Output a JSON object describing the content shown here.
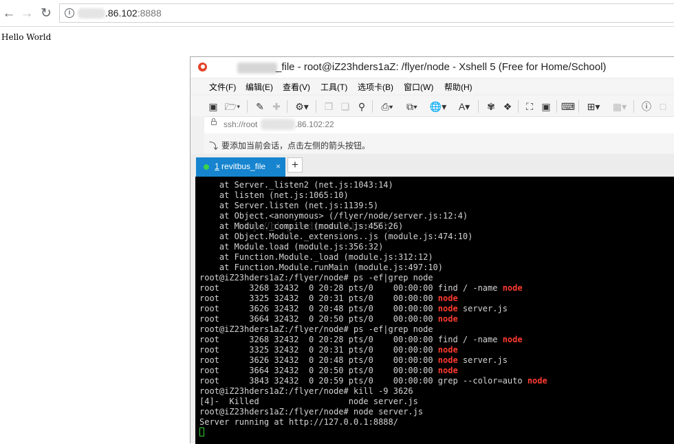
{
  "browser": {
    "url_host": ".86.102",
    "url_port": ":8888"
  },
  "page": {
    "text": "Hello World"
  },
  "xshell": {
    "title": "_file - root@iZ23hders1aZ: /flyer/node - Xshell 5 (Free for Home/School)",
    "menu": [
      "文件(F)",
      "编辑(E)",
      "查看(V)",
      "工具(T)",
      "选项卡(B)",
      "窗口(W)",
      "帮助(H)"
    ],
    "address": {
      "prefix": "ssh://root",
      "suffix": ".86.102:22"
    },
    "hint": "要添加当前会话，点击左侧的箭头按钮。",
    "tab": {
      "num": "1",
      "label": " revitbus_file",
      "close": "×",
      "add": "+"
    },
    "watermark": "http://blog.csdn.net/AlbertFly",
    "terminal_lines": [
      {
        "text": "    at Server._listen2 (net.js:1043:14)"
      },
      {
        "text": "    at listen (net.js:1065:10)"
      },
      {
        "text": "    at Server.listen (net.js:1139:5)"
      },
      {
        "text": "    at Object.<anonymous> (/flyer/node/server.js:12:4)"
      },
      {
        "text": "    at Module._compile (module.js:456:26)"
      },
      {
        "text": "    at Object.Module._extensions..js (module.js:474:10)"
      },
      {
        "text": "    at Module.load (module.js:356:32)"
      },
      {
        "text": "    at Function.Module._load (module.js:312:12)"
      },
      {
        "text": "    at Function.Module.runMain (module.js:497:10)"
      },
      {
        "text": "root@iZ23hders1aZ:/flyer/node# ps -ef|grep node"
      },
      {
        "text": "root      3268 32432  0 20:28 pts/0    00:00:00 find / -name ",
        "hl": "node"
      },
      {
        "text": "root      3325 32432  0 20:31 pts/0    00:00:00 ",
        "hl": "node"
      },
      {
        "text": "root      3626 32432  0 20:48 pts/0    00:00:00 ",
        "hl": "node",
        "after": " server.js"
      },
      {
        "text": "root      3664 32432  0 20:50 pts/0    00:00:00 ",
        "hl": "node"
      },
      {
        "text": "root@iZ23hders1aZ:/flyer/node# ps -ef|grep node"
      },
      {
        "text": "root      3268 32432  0 20:28 pts/0    00:00:00 find / -name ",
        "hl": "node"
      },
      {
        "text": "root      3325 32432  0 20:31 pts/0    00:00:00 ",
        "hl": "node"
      },
      {
        "text": "root      3626 32432  0 20:48 pts/0    00:00:00 ",
        "hl": "node",
        "after": " server.js"
      },
      {
        "text": "root      3664 32432  0 20:50 pts/0    00:00:00 ",
        "hl": "node"
      },
      {
        "text": "root      3843 32432  0 20:59 pts/0    00:00:00 grep --color=auto ",
        "hl": "node"
      },
      {
        "text": "root@iZ23hders1aZ:/flyer/node# kill -9 3626"
      },
      {
        "text": "[4]-  Killed                  node server.js"
      },
      {
        "text": "root@iZ23hders1aZ:/flyer/node# node server.js"
      },
      {
        "text": "Server running at http://127.0.0.1:8888/"
      }
    ]
  }
}
